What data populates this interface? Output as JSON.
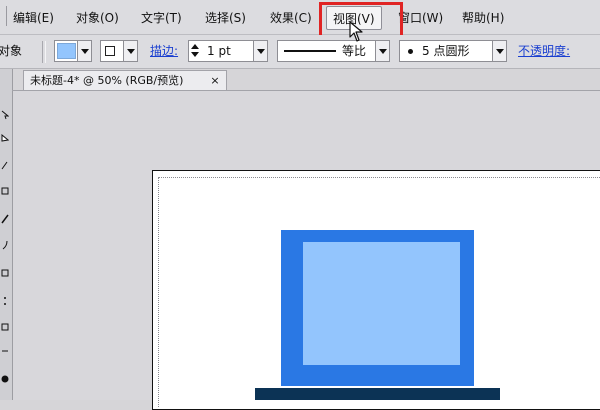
{
  "menubar": {
    "items": [
      {
        "label": "编辑(E)"
      },
      {
        "label": "对象(O)"
      },
      {
        "label": "文字(T)"
      },
      {
        "label": "选择(S)"
      },
      {
        "label": "效果(C)"
      },
      {
        "label": "视图(V)",
        "state": "open"
      },
      {
        "label": "窗口(W)"
      },
      {
        "label": "帮助(H)"
      }
    ],
    "highlight_color": "#e02424"
  },
  "controlbar": {
    "left_label": "对象",
    "fill_color": "#93c5fd",
    "stroke_label": "描边:",
    "stroke_weight": "1 pt",
    "stroke_profile": "等比",
    "brush": "5 点圆形",
    "opacity_label": "不透明度:"
  },
  "document": {
    "tab_title": "未标题-4* @ 50% (RGB/预览)",
    "tab_close": "×"
  },
  "artwork": {
    "monitor_frame_color": "#2a78e4",
    "monitor_screen_color": "#93c5fd",
    "monitor_base_color": "#0c3355"
  },
  "icons": {
    "cursor": "arrow-pointer-icon",
    "fill_swatch": "fill-swatch-icon",
    "stroke_swatch": "stroke-swatch-icon",
    "stepper": "stepper-icon",
    "bullet": "bullet-icon"
  }
}
